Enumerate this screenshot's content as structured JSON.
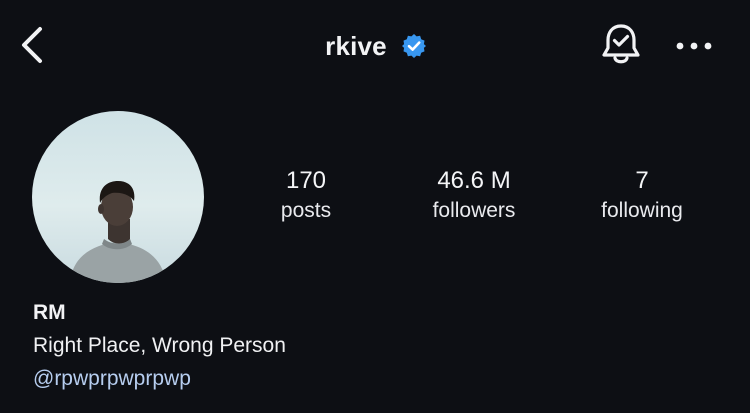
{
  "header": {
    "username": "rkive",
    "verified": true,
    "back_icon": "chevron-left-icon",
    "bell_icon": "bell-check-icon",
    "more_icon": "more-horizontal-icon"
  },
  "profile": {
    "stats": {
      "posts": {
        "value": "170",
        "label": "posts"
      },
      "followers": {
        "value": "46.6 M",
        "label": "followers"
      },
      "following": {
        "value": "7",
        "label": "following"
      }
    },
    "display_name": "RM",
    "bio": "Right Place, Wrong Person",
    "link": "@rpwprpwprpwp"
  },
  "colors": {
    "background": "#0d0f14",
    "text": "#f2f3f5",
    "verified_badge": "#3897f0",
    "link": "#b6cdef"
  }
}
